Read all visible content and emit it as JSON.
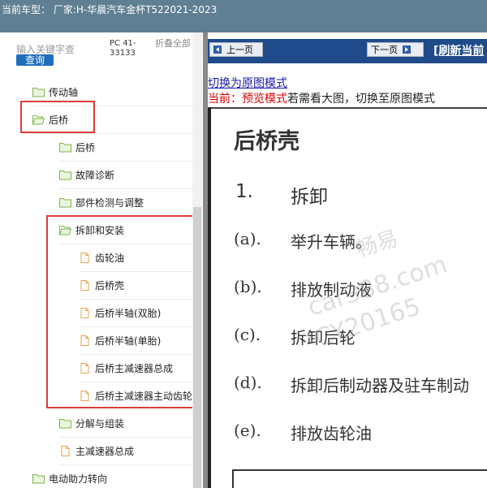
{
  "title_bar": {
    "text": "当前车型： 厂家:H-华晨汽车金杯T522021-2023"
  },
  "colors": {
    "title_bar": "#5f7f92",
    "nav_bar": "#1f4b8a",
    "query_button": "#1f6ebd",
    "highlight_box": "#e03b3b",
    "folder_icon": "#7ab648",
    "document_icon": "#e8a24a"
  },
  "sidebar": {
    "search_placeholder": "输入关键字查",
    "query_label": "查询",
    "pc_code": "PC 41-33133",
    "collapse_all": "折叠全部",
    "tree": [
      {
        "label": "传动轴",
        "icon": "folder-icon"
      },
      {
        "label": "后桥",
        "icon": "folder-open-icon"
      },
      {
        "label": "后桥",
        "icon": "folder-icon"
      },
      {
        "label": "故障诊断",
        "icon": "folder-icon"
      },
      {
        "label": "部件检测与调整",
        "icon": "folder-icon"
      },
      {
        "label": "拆卸和安装",
        "icon": "folder-open-icon"
      },
      {
        "label": "齿轮油",
        "icon": "document-icon"
      },
      {
        "label": "后桥壳",
        "icon": "document-icon"
      },
      {
        "label": "后桥半轴(双胎)",
        "icon": "document-icon"
      },
      {
        "label": "后桥半轴(单胎)",
        "icon": "document-icon"
      },
      {
        "label": "后桥主减速器总成",
        "icon": "document-icon"
      },
      {
        "label": "后桥主减速器主动齿轮",
        "icon": "document-icon"
      },
      {
        "label": "分解与组装",
        "icon": "folder-icon"
      },
      {
        "label": "主减速器总成",
        "icon": "document-icon"
      },
      {
        "label": "电动助力转向",
        "icon": "folder-icon"
      }
    ]
  },
  "content": {
    "prev_page": "上一页",
    "next_page": "下一页",
    "refresh_link": "[刷新当前",
    "switch_original": "切换为原图模式",
    "preview_prefix": "当前：预览模式",
    "preview_suffix": "若需看大图，切换至原图模式",
    "doc_title": "后桥壳",
    "section_number": "1.",
    "section_title": "拆卸",
    "steps": [
      {
        "letter": "(a).",
        "text": "举升车辆。"
      },
      {
        "letter": "(b).",
        "text": "排放制动液"
      },
      {
        "letter": "(c).",
        "text": "拆卸后轮"
      },
      {
        "letter": "(d).",
        "text": "拆卸后制动器及驻车制动"
      },
      {
        "letter": "(e).",
        "text": "排放齿轮油"
      }
    ],
    "watermarks": [
      "畅易",
      "car388.com",
      "CY20165"
    ]
  }
}
